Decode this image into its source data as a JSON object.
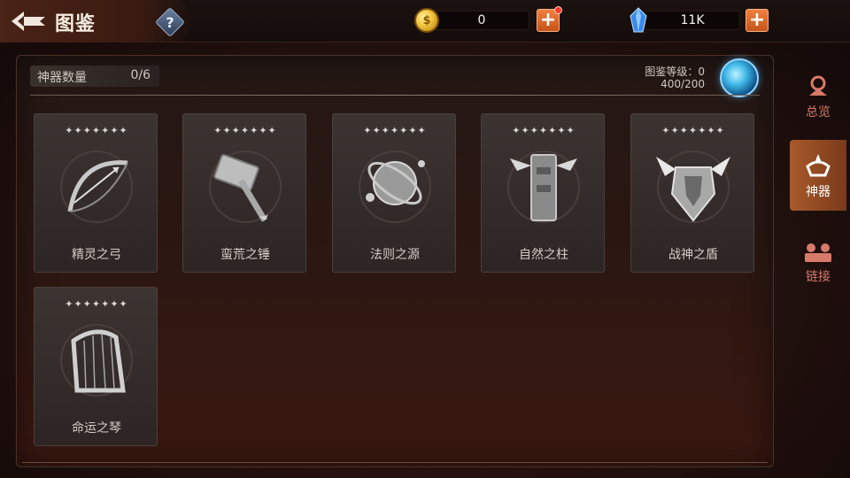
{
  "header": {
    "title": "图鉴",
    "help_symbol": "?"
  },
  "currencies": [
    {
      "icon": "gold-coin-icon",
      "value": "0",
      "has_notification": true
    },
    {
      "icon": "blue-gem-icon",
      "value": "11K",
      "has_notification": false
    }
  ],
  "summary": {
    "count_label": "神器数量",
    "count_value": "0/6",
    "level_label": "图鉴等级：0",
    "level_progress": "400/200"
  },
  "artifacts": [
    {
      "name": "精灵之弓",
      "stars": "✦✦✦✦✦✦✦",
      "icon": "bow-icon"
    },
    {
      "name": "蛮荒之锤",
      "stars": "✦✦✦✦✦✦✦",
      "icon": "hammer-icon"
    },
    {
      "name": "法则之源",
      "stars": "✦✦✦✦✦✦✦",
      "icon": "orb-of-rules-icon"
    },
    {
      "name": "自然之柱",
      "stars": "✦✦✦✦✦✦✦",
      "icon": "totem-pillar-icon"
    },
    {
      "name": "战神之盾",
      "stars": "✦✦✦✦✦✦✦",
      "icon": "winged-shield-icon"
    },
    {
      "name": "命运之琴",
      "stars": "✦✦✦✦✦✦✦",
      "icon": "harp-icon"
    }
  ],
  "side_tabs": [
    {
      "label": "总览",
      "active": false
    },
    {
      "label": "神器",
      "active": true
    },
    {
      "label": "链接",
      "active": false
    }
  ],
  "colors": {
    "accent_orange": "#e06a2a",
    "tab_inactive_text": "#d87a6a",
    "gold": "#f0c23a",
    "gem_blue": "#4aa8ff"
  }
}
